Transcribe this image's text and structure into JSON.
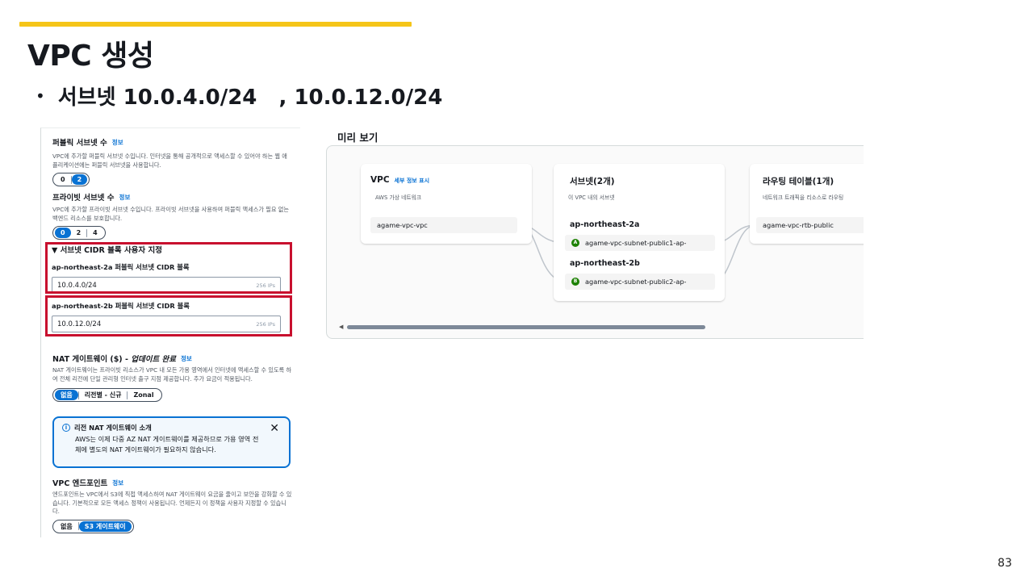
{
  "slide": {
    "title": "VPC 생성",
    "bullet": "서브넷 10.0.4.0/24   , 10.0.12.0/24",
    "page_number": "83",
    "accent_color": "#f5c518"
  },
  "console": {
    "public_subnets": {
      "label": "퍼블릭 서브넷 수",
      "info": "정보",
      "description": "VPC에 추가할 퍼블릭 서브넷 수입니다. 인터넷을 통해 공개적으로 액세스할 수 있어야 하는 웹 애플리케이션에는 퍼블릭 서브넷을 사용합니다.",
      "options": [
        "0",
        "2"
      ],
      "selected": "2"
    },
    "private_subnets": {
      "label": "프라이빗 서브넷 수",
      "info": "정보",
      "description": "VPC에 추가할 프라이빗 서브넷 수입니다. 프라이빗 서브넷을 사용하여 퍼블릭 액세스가 필요 없는 백엔드 리소스를 보호합니다.",
      "options": [
        "0",
        "2",
        "4"
      ],
      "selected": "0"
    },
    "cidr": {
      "toggle": "▼ 서브넷 CIDR 블록 사용자 지정",
      "blocks": [
        {
          "label": "ap-northeast-2a 퍼블릭 서브넷 CIDR 블록",
          "value": "10.0.4.0/24",
          "hint": "256 IPs"
        },
        {
          "label": "ap-northeast-2b 퍼블릭 서브넷 CIDR 블록",
          "value": "10.0.12.0/24",
          "hint": "256 IPs"
        }
      ]
    },
    "nat": {
      "label": "NAT 게이트웨이 ($) - ",
      "label_em": "업데이트 완료",
      "info": "정보",
      "description": "NAT 게이트웨이는 프라이빗 리소스가 VPC 내 모든 가용 영역에서 인터넷에 액세스할 수 있도록 하여 전체 리전에 단일 관리형 인터넷 출구 지점 제공합니다. 추가 요금이 적용됩니다.",
      "options": [
        "없음",
        "리전별 - 신규",
        "Zonal"
      ],
      "selected": "없음"
    },
    "alert": {
      "title": "리전 NAT 게이트웨이 소개",
      "body": "AWS는 이제 다중 AZ NAT 게이트웨이를 제공하므로 가용 영역 전체에 별도의 NAT 게이트웨이가 필요하지 않습니다.",
      "close": "✕"
    },
    "endpoint": {
      "label": "VPC 엔드포인트",
      "info": "정보",
      "description": "엔드포인트는 VPC에서 S3에 직접 액세스하여 NAT 게이트웨이 요금을 줄이고 보안을 강화할 수 있습니다. 기본적으로 모든 액세스 정책이 사용됩니다. 언제든지 이 정책을 사용자 지정할 수 있습니다.",
      "options": [
        "없음",
        "S3 게이트웨이"
      ],
      "selected": "S3 게이트웨이"
    }
  },
  "preview": {
    "title": "미리 보기",
    "vpc": {
      "title": "VPC",
      "link": "세부 정보 표시",
      "subtitle": "AWS 가상 네트워크",
      "item": "agame-vpc-vpc"
    },
    "subnets": {
      "title": "서브넷(2개)",
      "subtitle": "이 VPC 내의 서브넷",
      "zones": [
        {
          "az": "ap-northeast-2a",
          "badge": "A",
          "name": "agame-vpc-subnet-public1-ap-"
        },
        {
          "az": "ap-northeast-2b",
          "badge": "B",
          "name": "agame-vpc-subnet-public2-ap-"
        }
      ]
    },
    "route_tables": {
      "title": "라우팅 테이블(1개)",
      "subtitle": "네트워크 트래픽을 리소스로 라우팅",
      "item": "agame-vpc-rtb-public"
    },
    "scroll_arrow": "◀"
  }
}
